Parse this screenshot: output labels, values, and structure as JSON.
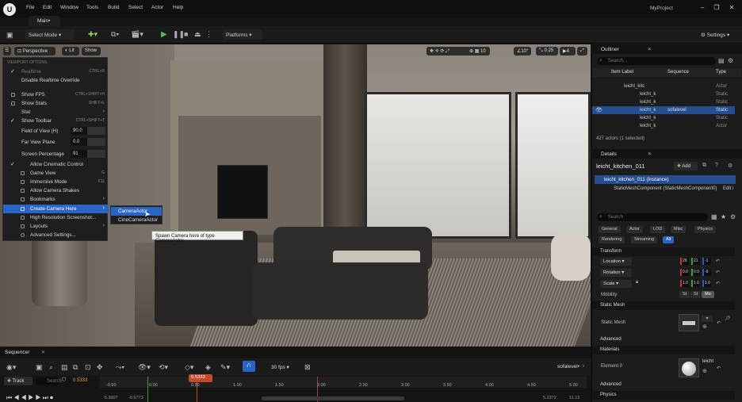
{
  "titlebar": {
    "menus": [
      "File",
      "Edit",
      "Window",
      "Tools",
      "Build",
      "Select",
      "Actor",
      "Help"
    ],
    "project": "MyProject",
    "tab": "Main•"
  },
  "toolbar": {
    "select_mode": "Select Mode",
    "platforms": "Platforms",
    "settings": "Settings"
  },
  "viewport": {
    "perspective": "Perspective",
    "lit": "Lit",
    "show": "Show",
    "snap_angle": "10°",
    "snap_scale": "0.25",
    "camera_speed": "4",
    "grid": "10"
  },
  "viewport_menu": {
    "header": "VIEWPORT OPTIONS",
    "items": [
      {
        "label": "Realtime",
        "shortcut": "CTRL+R",
        "check": "✓",
        "dim": true
      },
      {
        "label": "Disable Realtime Override",
        "shortcut": "",
        "check": ""
      },
      {
        "label": "Show FPS",
        "shortcut": "CTRL+SHIFT+H",
        "check": ""
      },
      {
        "label": "Show Stats",
        "shortcut": "SHIFT+L",
        "check": ""
      },
      {
        "label": "Stat",
        "shortcut": "",
        "check": "",
        "arrow": true
      },
      {
        "label": "Show Toolbar",
        "shortcut": "CTRL+SHIFT+T",
        "check": "✓"
      },
      {
        "label": "Field of View (H)",
        "value": "90.0"
      },
      {
        "label": "Far View Plane",
        "value": "0.0"
      },
      {
        "label": "Screen Percentage",
        "value": "91"
      },
      {
        "label": "Allow Cinematic Control",
        "shortcut": "",
        "check": "✓"
      },
      {
        "label": "Game View",
        "shortcut": "G",
        "check": ""
      },
      {
        "label": "Immersive Mode",
        "shortcut": "F11",
        "check": ""
      },
      {
        "label": "Allow Camera Shakes",
        "shortcut": "",
        "check": ""
      },
      {
        "label": "Bookmarks",
        "shortcut": "",
        "check": "",
        "arrow": true
      },
      {
        "label": "Create Camera Here",
        "shortcut": "",
        "check": "",
        "arrow": true,
        "highlight": true
      },
      {
        "label": "High Resolution Screenshot...",
        "shortcut": "",
        "check": ""
      },
      {
        "label": "Layouts",
        "shortcut": "",
        "check": "",
        "arrow": true
      },
      {
        "label": "Advanced Settings...",
        "shortcut": "",
        "check": ""
      }
    ]
  },
  "submenu": {
    "items": [
      "CameraActor",
      "CineCameraActor"
    ],
    "tooltip": "Spawn Camera here of type CameraActor"
  },
  "outliner": {
    "title": "Outliner",
    "search": "Search...",
    "col_label": "Item Label",
    "col_sequence": "Sequence",
    "col_type": "Type",
    "rows": [
      {
        "name": "leicht_kitc",
        "type": "Actor",
        "sub": ""
      },
      {
        "name": "leicht_k",
        "type": "Static",
        "sub": ""
      },
      {
        "name": "leicht_k",
        "type": "Static",
        "sub": ""
      },
      {
        "name": "leicht_k",
        "type": "Static",
        "sub": "sofalevel"
      },
      {
        "name": "leicht_k",
        "type": "Static",
        "sub": ""
      },
      {
        "name": "leicht_k",
        "type": "Actor",
        "sub": ""
      }
    ],
    "footer": "427 actors (1 selected)"
  },
  "details": {
    "title": "Details",
    "actor": "leicht_kitchen_011",
    "add": "Add",
    "instance": "leicht_kitchen_011 (Instance)",
    "component": "StaticMeshComponent (StaticMeshComponent0)",
    "edit": "Edit i",
    "search": "Search",
    "filters": [
      "General",
      "Actor",
      "LOD",
      "Misc",
      "Physics",
      "Rendering",
      "Streaming",
      "All"
    ],
    "transform": "Transform",
    "location": "Location",
    "rotation": "Rotation",
    "scale": "Scale",
    "loc_vals": [
      "29",
      "21",
      "-1"
    ],
    "rot_vals": [
      "0.0",
      "0.0",
      "-9"
    ],
    "scale_vals": [
      "1.0",
      "1.0",
      "1.0"
    ],
    "mobility": "Mobility",
    "mobility_opts": [
      "St",
      "St",
      "Mo"
    ],
    "static_mesh_section": "Static Mesh",
    "static_mesh_label": "Static Mesh",
    "advanced": "Advanced",
    "materials": "Materials",
    "element0": "Element 0",
    "material_name": "leicht",
    "physics": "Physics"
  },
  "sequencer": {
    "title": "Sequencer",
    "track": "Track",
    "search": "Search",
    "fps": "30 fps",
    "sequence": "sofalevel•",
    "current_time": "0.5333",
    "time_field": "0.5333",
    "ticks": [
      "-0.50",
      "0.00",
      "0.50",
      "1.00",
      "1.50",
      "2.00",
      "2.50",
      "3.00",
      "3.50",
      "4.00",
      "4.50",
      "5.00"
    ],
    "bottom_left": "-5.3607",
    "bottom_left2": "-0.5773",
    "bottom_right": "5.2372",
    "bottom_right2": "11.12"
  }
}
